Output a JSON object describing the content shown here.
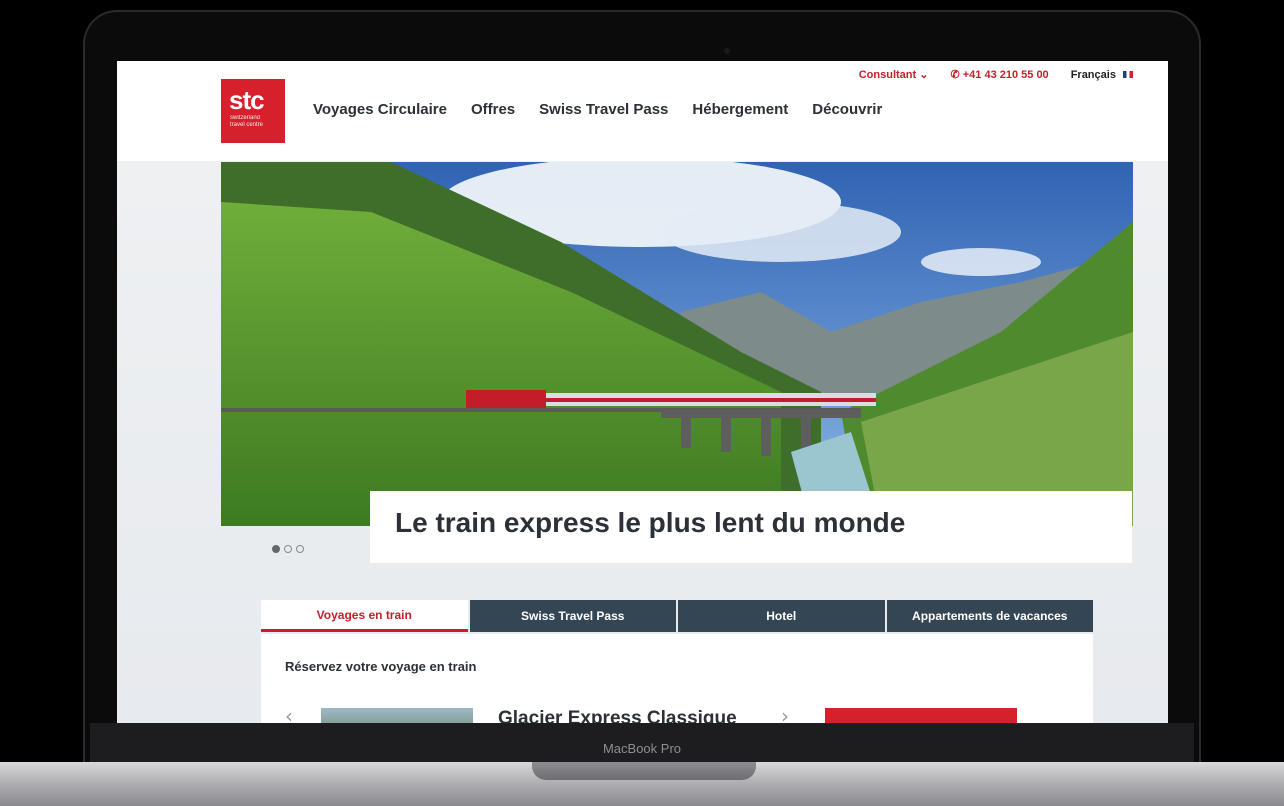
{
  "header": {
    "logo_big": "stc",
    "logo_small_1": "switzerland",
    "logo_small_2": "travel centre",
    "topbar": {
      "consultant": "Consultant",
      "phone": "+41 43 210 55 00",
      "language": "Français"
    },
    "nav": [
      "Voyages Circulaire",
      "Offres",
      "Swiss Travel Pass",
      "Hébergement",
      "Découvrir"
    ]
  },
  "hero": {
    "caption": "Le train express le plus lent du monde",
    "slides": 3,
    "active_slide": 1
  },
  "booking": {
    "tabs": [
      "Voyages en train",
      "Swiss Travel Pass",
      "Hotel",
      "Appartements de vacances"
    ],
    "active_tab": 0,
    "panel_title": "Réservez votre voyage en train",
    "result_title": "Glacier Express Classique"
  },
  "device": {
    "label": "MacBook Pro"
  },
  "colors": {
    "brand_red": "#d6202b",
    "tab_navy": "#344654",
    "text_dark": "#2b3137"
  }
}
